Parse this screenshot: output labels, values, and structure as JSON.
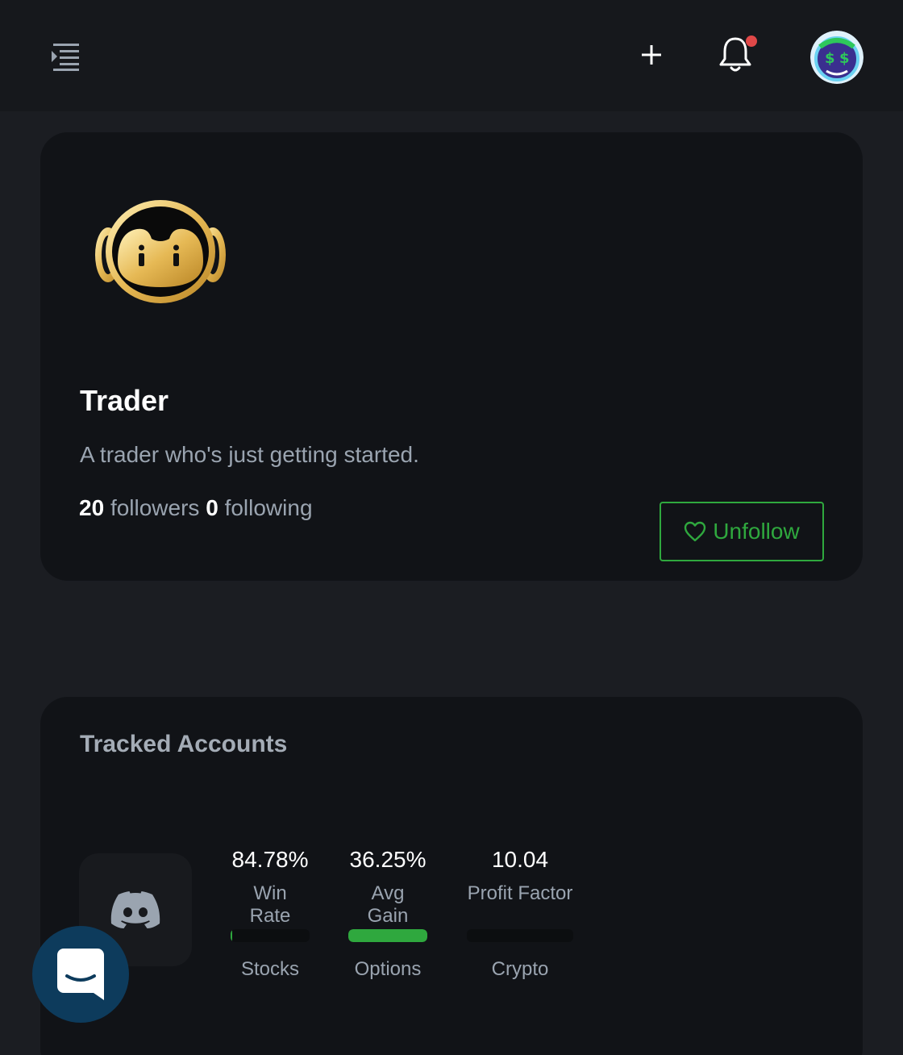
{
  "header": {
    "menu_icon": "indent-menu-icon",
    "add_icon": "plus-icon",
    "notifications_icon": "bell-icon",
    "notification_dot_color": "#e04848",
    "avatar": "user-avatar"
  },
  "profile": {
    "name": "Trader",
    "bio": "A trader who's just getting started.",
    "followers_count": "20",
    "followers_label": "followers",
    "following_count": "0",
    "following_label": "following",
    "unfollow_label": "Unfollow",
    "unfollow_icon": "heart-icon",
    "accent_color": "#2fa83e"
  },
  "tracked": {
    "title": "Tracked Accounts",
    "account_icon": "discord-icon",
    "stats": [
      {
        "value": "84.78%",
        "label": "Win Rate",
        "category": "Stocks",
        "fill": 0.02
      },
      {
        "value": "36.25%",
        "label": "Avg Gain",
        "category": "Options",
        "fill": 1.0
      },
      {
        "value": "10.04",
        "label": "Profit Factor",
        "category": "Crypto",
        "fill": 0.0
      }
    ]
  },
  "support_chat": {
    "icon": "chat-icon"
  }
}
